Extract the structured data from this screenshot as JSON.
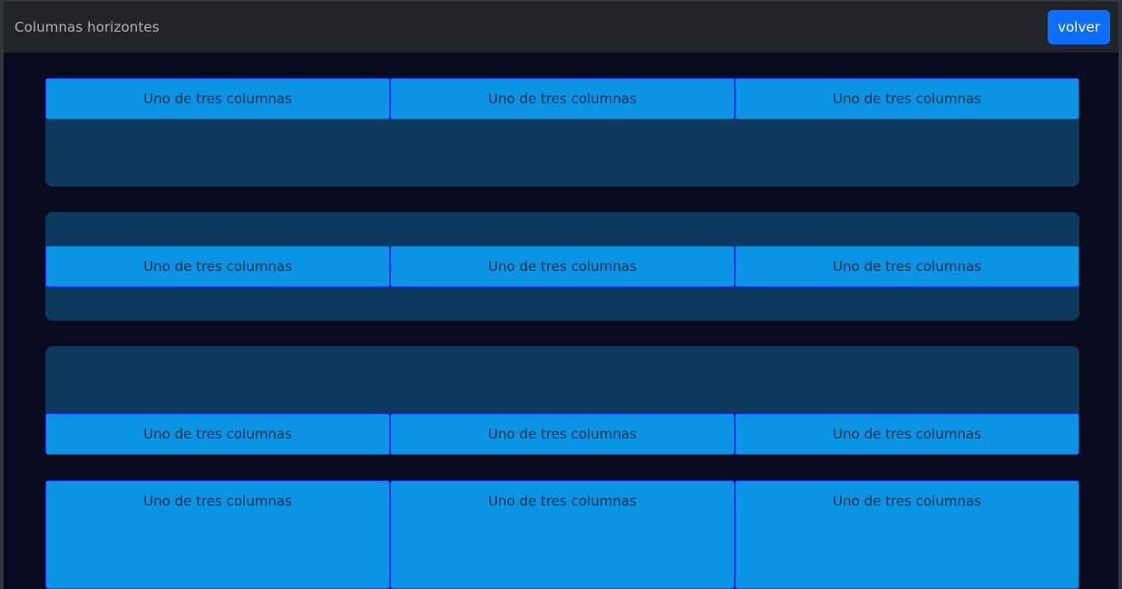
{
  "navbar": {
    "title": "Columnas horizontes",
    "back_label": "volver"
  },
  "rows": [
    {
      "columns": [
        "Uno de tres columnas",
        "Uno de tres columnas",
        "Uno de tres columnas"
      ]
    },
    {
      "columns": [
        "Uno de tres columnas",
        "Uno de tres columnas",
        "Uno de tres columnas"
      ]
    },
    {
      "columns": [
        "Uno de tres columnas",
        "Uno de tres columnas",
        "Uno de tres columnas"
      ]
    },
    {
      "columns": [
        "Uno de tres columnas",
        "Uno de tres columnas",
        "Uno de tres columnas"
      ]
    }
  ],
  "colors": {
    "page_bg": "#080a1e",
    "navbar_bg": "#212529",
    "button_primary": "#0d6efd",
    "row_bg": "#0d3a5c",
    "column_bg": "#0b94e3",
    "column_border": "#1032ff"
  }
}
